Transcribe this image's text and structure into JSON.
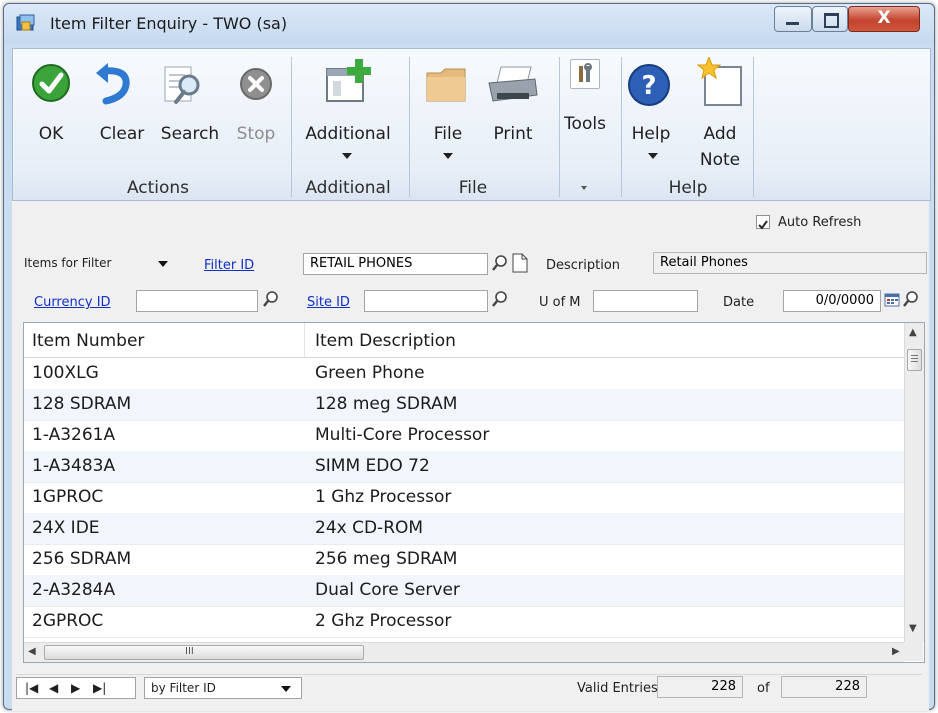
{
  "window": {
    "title": "Item Filter Enquiry  -  TWO (sa)",
    "minimize_glyph": "—",
    "maximize_glyph": "☐",
    "close_glyph": "X"
  },
  "ribbon": {
    "actions": {
      "ok": "OK",
      "clear": "Clear",
      "search": "Search",
      "stop": "Stop",
      "group": "Actions"
    },
    "additional": {
      "additional": "Additional",
      "group": "Additional"
    },
    "file": {
      "file": "File",
      "print": "Print",
      "group": "File"
    },
    "tools": {
      "tools": "Tools"
    },
    "help": {
      "help": "Help",
      "add_note_line1": "Add",
      "add_note_line2": "Note",
      "group": "Help"
    }
  },
  "form": {
    "auto_refresh_label": "Auto Refresh",
    "auto_refresh_checked": true,
    "items_for_filter": "Items for Filter",
    "filter_id_label": "Filter ID",
    "filter_id_value": "RETAIL PHONES",
    "description_label": "Description",
    "description_value": "Retail Phones",
    "currency_id_label": "Currency ID",
    "currency_id_value": "",
    "site_id_label": "Site ID",
    "site_id_value": "",
    "uofm_label": "U of M",
    "uofm_value": "",
    "date_label": "Date",
    "date_value": "0/0/0000"
  },
  "grid": {
    "columns": [
      "Item Number",
      "Item Description"
    ],
    "rows": [
      [
        "100XLG",
        "Green Phone"
      ],
      [
        "128 SDRAM",
        "128 meg SDRAM"
      ],
      [
        "1-A3261A",
        "Multi-Core Processor"
      ],
      [
        "1-A3483A",
        "SIMM EDO 72"
      ],
      [
        "1GPROC",
        "1 Ghz Processor"
      ],
      [
        "24X IDE",
        "24x CD-ROM"
      ],
      [
        "256 SDRAM",
        "256 meg SDRAM"
      ],
      [
        "2-A3284A",
        "Dual Core Server"
      ],
      [
        "2GPROC",
        "2 Ghz Processor"
      ]
    ],
    "hscroll_grip": "III"
  },
  "footer": {
    "sort_by": "by Filter ID",
    "valid_entries_label": "Valid Entries",
    "valid_entries_value": "228",
    "of_label": "of",
    "total_value": "228"
  },
  "colors": {
    "ok_green": "#3aa33a",
    "help_blue": "#2c5fb5",
    "link_blue": "#1030c8",
    "close_red": "#c2452f"
  }
}
